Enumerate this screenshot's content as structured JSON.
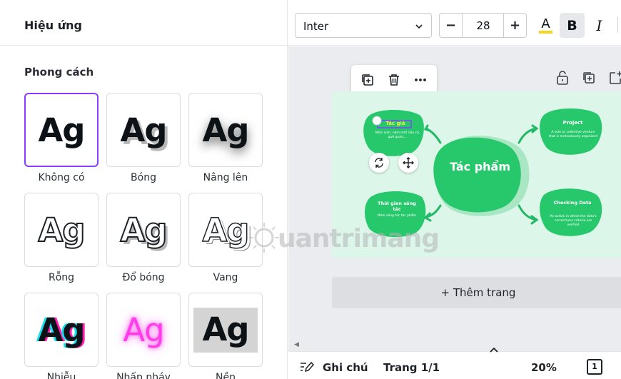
{
  "panel": {
    "title": "Hiệu ứng",
    "section_title": "Phong cách",
    "styles": [
      {
        "sample": "Ag",
        "label": "Không có"
      },
      {
        "sample": "Ag",
        "label": "Bóng"
      },
      {
        "sample": "Ag",
        "label": "Nâng lên"
      },
      {
        "sample": "Ag",
        "label": "Rỗng"
      },
      {
        "sample": "Ag",
        "label": "Đổ bóng"
      },
      {
        "sample": "Ag",
        "label": "Vang"
      },
      {
        "sample": "Ag",
        "label": "Nhiễu"
      },
      {
        "sample": "Ag",
        "label": "Nhấp nháy"
      },
      {
        "sample": "Ag",
        "label": "Nền"
      }
    ]
  },
  "toolbar": {
    "font_family": "Inter",
    "font_size": "28",
    "minus": "−",
    "plus": "+",
    "text_color_glyph": "A",
    "text_color_swatch": "#f6d61c",
    "bold_glyph": "B",
    "italic_glyph": "I"
  },
  "canvas": {
    "add_page_label": "+ Thêm trang",
    "mindmap": {
      "center": "Tác phẩm",
      "nodes": [
        {
          "title": "Tác giả",
          "body": "Năm sinh, năm mất nếu có, quê quán,..."
        },
        {
          "title": "Project",
          "body": "A solo or collective venture that is meticulously organized"
        },
        {
          "title": "Thời gian sáng tác",
          "body": "Năm sáng tác tác phẩm"
        },
        {
          "title": "Checking Data",
          "body": "An action in which the data's correctness criteria are verified"
        }
      ]
    },
    "colors": {
      "page_bg": "#dcf7ea",
      "blob": "#27c86b",
      "blob_shadow": "#a9e7c4",
      "arrow": "#22b866",
      "selection": "#8b3dff"
    }
  },
  "bottom_bar": {
    "notes_label": "Ghi chú",
    "page_label": "Trang 1/1",
    "zoom": "20%",
    "page_count": "1"
  },
  "watermark": {
    "text": "uantrimang"
  }
}
